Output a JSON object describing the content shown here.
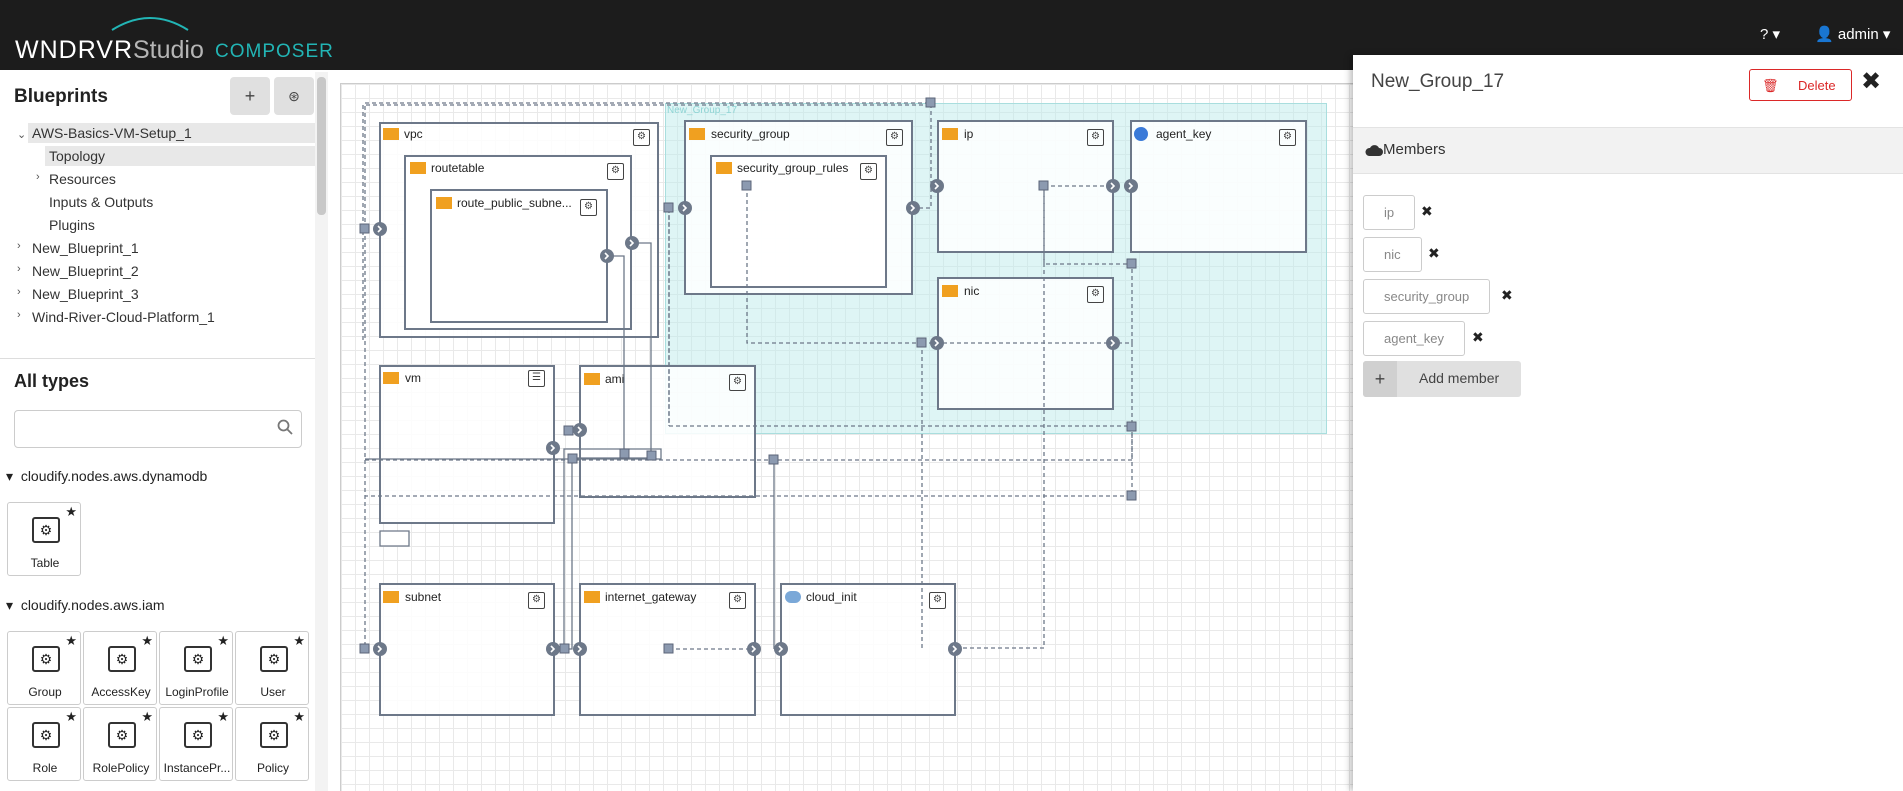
{
  "header": {
    "logo_text": "WNDRVR",
    "studio": "Studio",
    "composer": "COMPOSER",
    "help_label": "?",
    "user_label": "admin"
  },
  "sidebar": {
    "blueprints_title": "Blueprints",
    "tree": [
      {
        "label": "AWS-Basics-VM-Setup_1",
        "expanded": true
      },
      {
        "label": "Topology"
      },
      {
        "label": "Resources"
      },
      {
        "label": "Inputs & Outputs"
      },
      {
        "label": "Plugins"
      },
      {
        "label": "New_Blueprint_1"
      },
      {
        "label": "New_Blueprint_2"
      },
      {
        "label": "New_Blueprint_3"
      },
      {
        "label": "Wind-River-Cloud-Platform_1"
      }
    ],
    "types_title": "All types",
    "search_placeholder": "",
    "categories": [
      {
        "name": "cloudify.nodes.aws.dynamodb",
        "items": [
          "Table"
        ]
      },
      {
        "name": "cloudify.nodes.aws.iam",
        "items": [
          "Group",
          "AccessKey",
          "LoginProfile",
          "User",
          "Role",
          "RolePolicy",
          "InstancePr...",
          "Policy"
        ]
      }
    ]
  },
  "topology": {
    "group_label": "New_Group_17",
    "nodes": [
      "vpc",
      "routetable",
      "route_public_subne...",
      "security_group",
      "security_group_rules",
      "ip",
      "agent_key",
      "nic",
      "vm",
      "ami",
      "subnet",
      "internet_gateway",
      "cloud_init"
    ]
  },
  "panel": {
    "title": "New_Group_17",
    "delete_label": "Delete",
    "members_title": "Members",
    "members": [
      "ip",
      "nic",
      "security_group",
      "agent_key"
    ],
    "add_member_label": "Add member"
  },
  "colors": {
    "accent": "#22b5b5",
    "danger": "#db2828",
    "group_fill": "#d9f3f3",
    "node_border": "#6d7889",
    "topbar": "#1c1c1c"
  }
}
